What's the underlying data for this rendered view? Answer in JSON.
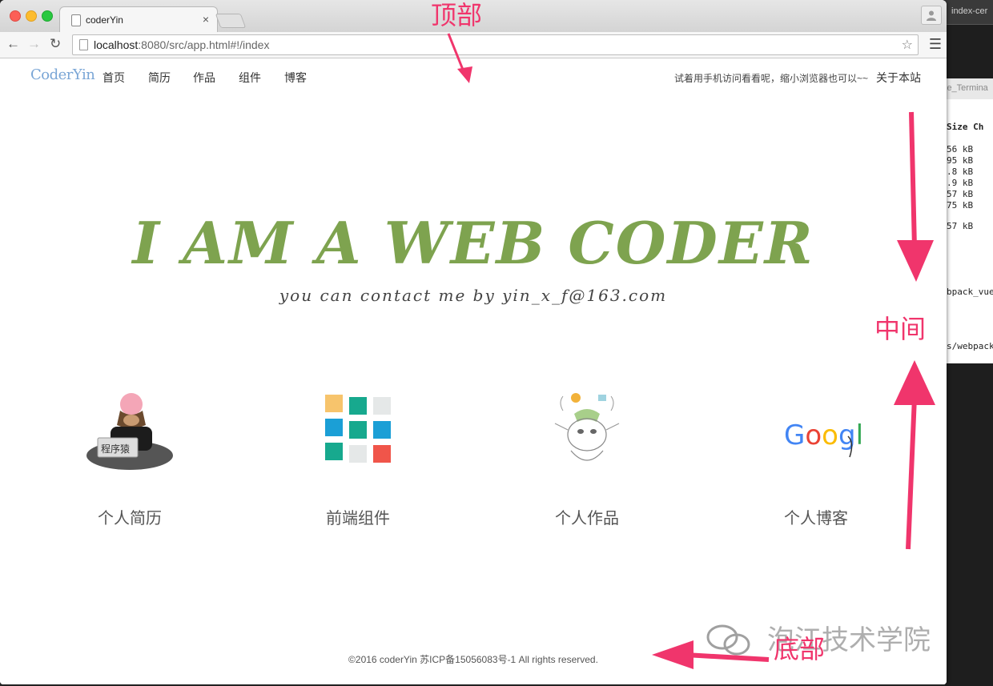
{
  "terminal": {
    "tab_title": "index-cer",
    "sub_title": "le_Termina",
    "header": "Size  Ch",
    "lines": [
      "56 kB",
      "95 kB",
      ".8 kB",
      ".9 kB",
      "57 kB",
      "75 kB",
      "",
      "57 kB"
    ],
    "extra_1": "bpack_vue",
    "extra_2": "s/webpack"
  },
  "browser": {
    "tab_title": "coderYin",
    "tab_close": "×",
    "url_host": "localhost",
    "url_rest": ":8080/src/app.html#!/index"
  },
  "site": {
    "logo": "CoderYin",
    "nav": [
      "首页",
      "简历",
      "作品",
      "组件",
      "博客"
    ],
    "tip": "试着用手机访问看看呢，缩小浏览器也可以~~",
    "about": "关于本站",
    "hero_title": "I AM A WEB CODER",
    "hero_sub": "you can contact me by yin_x_f@163.com",
    "cards": [
      {
        "label": "个人简历",
        "icon": "programmer-ape-icon"
      },
      {
        "label": "前端组件",
        "icon": "color-grid-icon"
      },
      {
        "label": "个人作品",
        "icon": "doodle-cow-icon"
      },
      {
        "label": "个人博客",
        "icon": "google-logo-icon"
      }
    ],
    "card_art_text": {
      "ape": "程序猿",
      "google": "Googl"
    },
    "footer": "©2016 coderYin 苏ICP备15056083号-1 All rights reserved."
  },
  "annotations": {
    "top": "顶部",
    "middle": "中间",
    "bottom": "底部",
    "watermark": "泡江技术学院",
    "color": "#f0356c"
  },
  "colors": {
    "hero_green": "#7ea34f",
    "logo_blue": "#7aa6d6",
    "grid": [
      "#f7c46c",
      "#17a98e",
      "#e5e8e8",
      "#1b9fd6",
      "#17a98e",
      "#1b9fd6",
      "#17a98e",
      "#e5e8e8",
      "#f0554a"
    ]
  }
}
